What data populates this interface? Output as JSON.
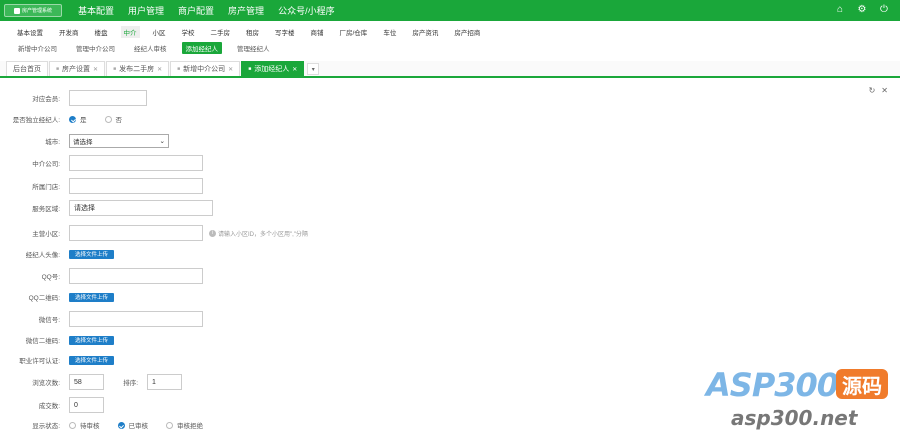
{
  "topbar": {
    "logo": "房产管理系统",
    "nav": [
      "基本配置",
      "用户管理",
      "商户配置",
      "房产管理",
      "公众号/小程序"
    ],
    "icons": [
      "home-icon",
      "gear-icon",
      "power-icon"
    ]
  },
  "subnav": [
    "基本设置",
    "开发商",
    "楼盘",
    "中介",
    "小区",
    "学校",
    "二手房",
    "租房",
    "写字楼",
    "商铺",
    "厂房/仓库",
    "车位",
    "房产资讯",
    "房产招商"
  ],
  "subnav_active": 3,
  "thirdnav": [
    "新增中介公司",
    "管理中介公司",
    "经纪人审核",
    "添加经纪人",
    "管理经纪人"
  ],
  "thirdnav_active": 3,
  "tabs": [
    {
      "label": "后台首页",
      "closable": false
    },
    {
      "label": "房产设置",
      "closable": true
    },
    {
      "label": "发布二手房",
      "closable": true
    },
    {
      "label": "新增中介公司",
      "closable": true
    },
    {
      "label": "添加经纪人",
      "closable": true,
      "active": true
    }
  ],
  "form": {
    "member": {
      "label": "对应会员:",
      "value": ""
    },
    "independent": {
      "label": "是否独立经纪人:",
      "options": [
        "是",
        "否"
      ],
      "selected": 0
    },
    "city": {
      "label": "城市:",
      "value": "请选择"
    },
    "company": {
      "label": "中介公司:",
      "value": ""
    },
    "store": {
      "label": "所属门店:",
      "value": ""
    },
    "area": {
      "label": "服务区域:",
      "value": "请选择"
    },
    "community": {
      "label": "主营小区:",
      "value": "",
      "hint": "请输入小区ID，多个小区用\",\"分隔"
    },
    "avatar": {
      "label": "经纪人头像:",
      "button": "选择文件上传"
    },
    "qq": {
      "label": "QQ号:",
      "value": ""
    },
    "qq_qr": {
      "label": "QQ二维码:",
      "button": "选择文件上传"
    },
    "wechat": {
      "label": "微信号:",
      "value": ""
    },
    "wechat_qr": {
      "label": "微信二维码:",
      "button": "选择文件上传"
    },
    "license": {
      "label": "职业许可认证:",
      "button": "选择文件上传"
    },
    "views": {
      "label": "浏览次数:",
      "value": "58"
    },
    "sort": {
      "label": "排序:",
      "value": "1"
    },
    "deals": {
      "label": "成交数:",
      "value": "0"
    },
    "status": {
      "label": "显示状态:",
      "options": [
        "待审核",
        "已审核",
        "审核拒绝"
      ],
      "selected": 1
    }
  },
  "watermark": {
    "brand": "ASP300",
    "badge": "源码",
    "url": "asp300.net"
  }
}
